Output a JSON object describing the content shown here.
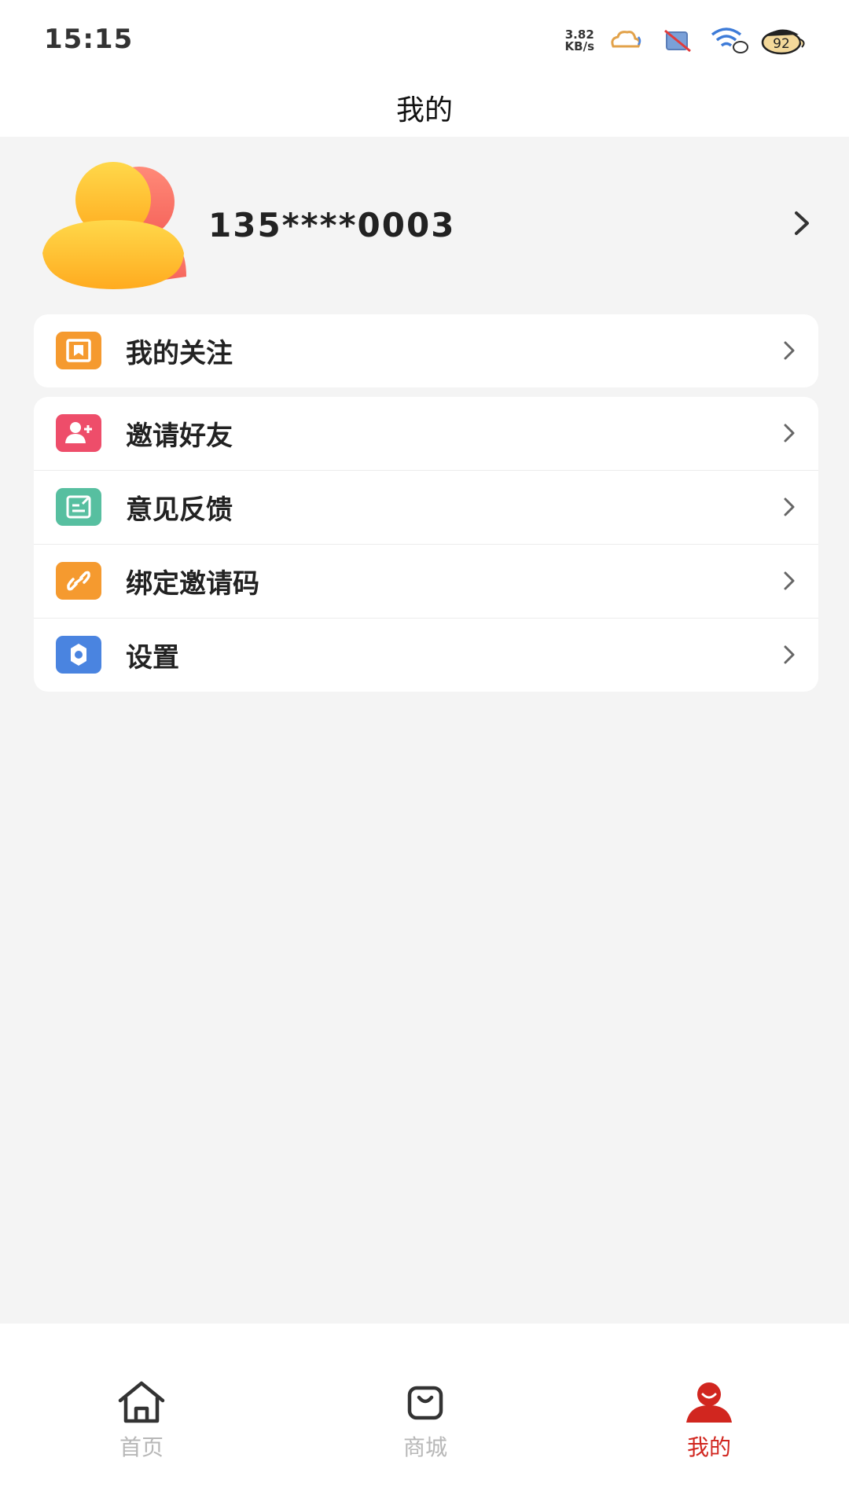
{
  "status_bar": {
    "time": "15:15",
    "net_speed_value": "3.82",
    "net_speed_unit": "KB/s",
    "battery": "92",
    "icons": [
      "cloud-star-icon",
      "sim-off-icon",
      "wifi-icon",
      "battery-icon"
    ]
  },
  "header": {
    "title": "我的"
  },
  "profile": {
    "phone": "135****0003"
  },
  "menu_group_1": [
    {
      "label": "我的关注",
      "icon": "bookmark-icon",
      "color": "#f59a2f"
    }
  ],
  "menu_group_2": [
    {
      "label": "邀请好友",
      "icon": "add-user-icon",
      "color": "#ee4d6a"
    },
    {
      "label": "意见反馈",
      "icon": "feedback-icon",
      "color": "#57bfa0"
    },
    {
      "label": "绑定邀请码",
      "icon": "link-icon",
      "color": "#f59a2f"
    },
    {
      "label": "设置",
      "icon": "gear-icon",
      "color": "#4a84e0"
    }
  ],
  "bottom_nav": {
    "items": [
      {
        "label": "首页",
        "icon": "home-icon",
        "active": false
      },
      {
        "label": "商城",
        "icon": "shopping-bag-icon",
        "active": false
      },
      {
        "label": "我的",
        "icon": "user-icon",
        "active": true
      }
    ],
    "active_color": "#d1261f",
    "inactive_color": "#b7b7b7"
  }
}
